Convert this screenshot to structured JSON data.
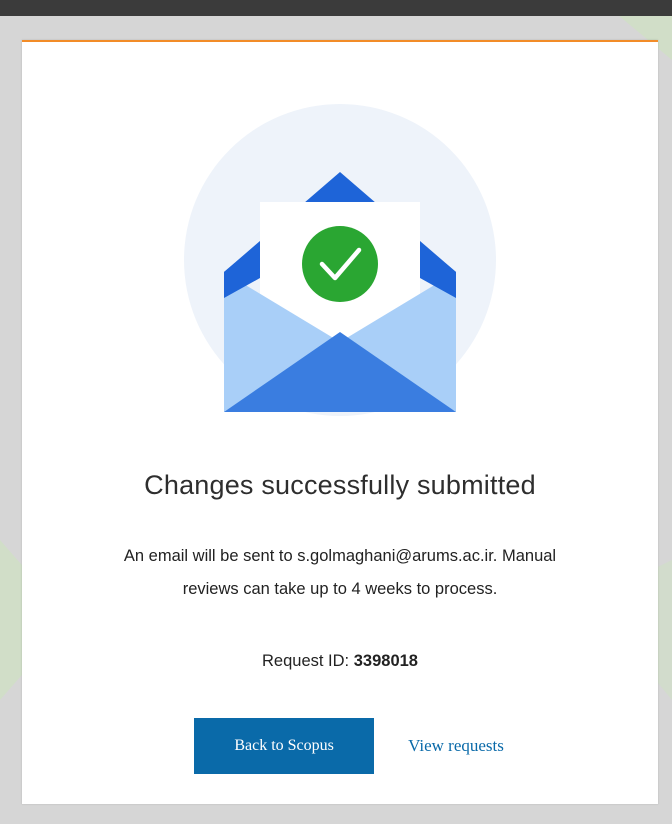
{
  "dialog": {
    "title": "Changes successfully submitted",
    "message_line1": "An email will be sent to s.golmaghani@arums.ac.ir. Manual",
    "message_line2": "reviews can take up to 4 weeks to process.",
    "request_label": "Request ID: ",
    "request_id": "3398018",
    "primary_button": "Back to Scopus",
    "secondary_link": "View requests"
  },
  "icons": {
    "illustration": "envelope-with-check-icon",
    "check": "check-icon"
  },
  "colors": {
    "accent_border": "#f28c28",
    "primary_button": "#0a6aa9",
    "link": "#0a6aa9",
    "envelope_dark": "#1e64d8",
    "envelope_light": "#a9cff8",
    "check_green": "#2aa632"
  }
}
